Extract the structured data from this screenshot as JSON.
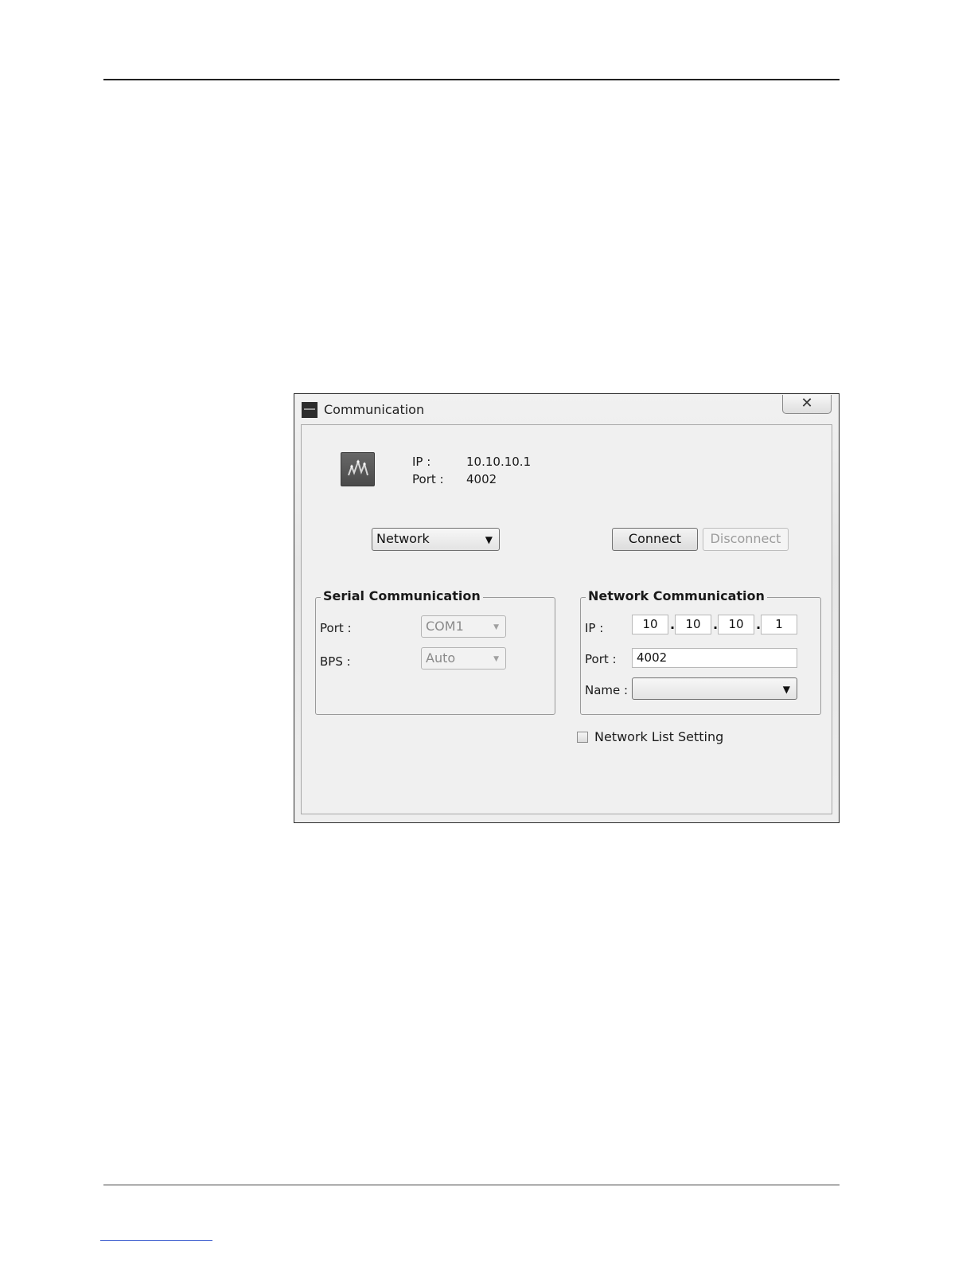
{
  "dialog": {
    "title": "Communication",
    "close_glyph": "☒",
    "status": {
      "ip_label": "IP :",
      "ip_value": "10.10.10.1",
      "port_label": "Port :",
      "port_value": "4002"
    },
    "mode_select": {
      "value": "Network",
      "arrow": "▼"
    },
    "connect_label": "Connect",
    "disconnect_label": "Disconnect",
    "serial": {
      "title": "Serial Communication",
      "port_label": "Port :",
      "port_value": "COM1",
      "bps_label": "BPS :",
      "bps_value": "Auto",
      "arrow": "▼"
    },
    "network": {
      "title": "Network Communication",
      "ip_label": "IP :",
      "ip_octets": [
        "10",
        "10",
        "10",
        "1"
      ],
      "dot": ".",
      "port_label": "Port :",
      "port_value": "4002",
      "name_label": "Name :",
      "name_value": "",
      "arrow": "▼"
    },
    "network_list_label": "Network List Setting"
  }
}
